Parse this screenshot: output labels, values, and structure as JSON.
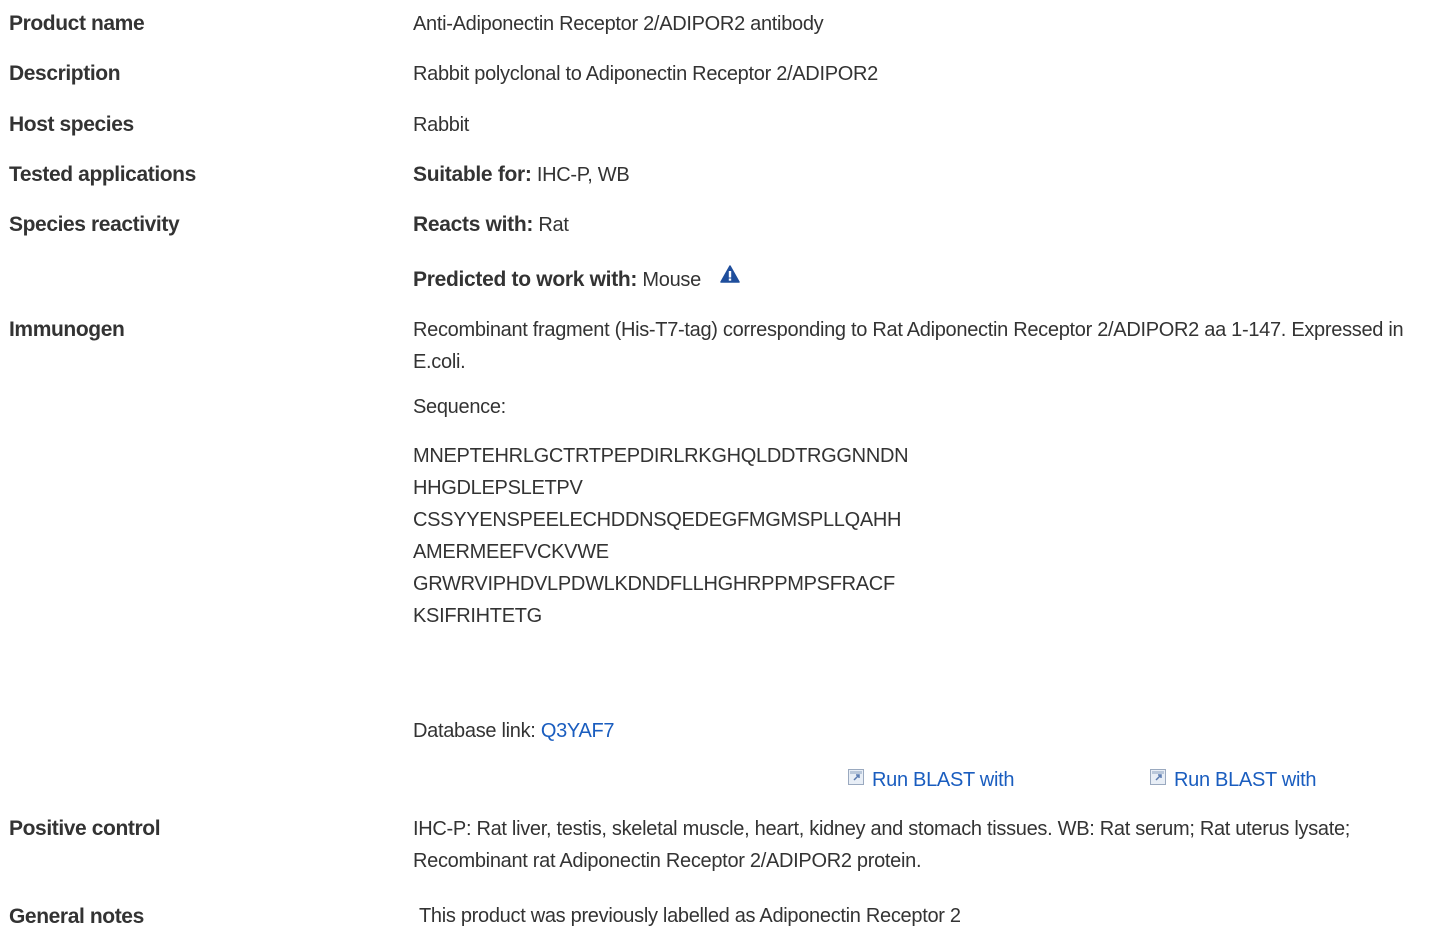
{
  "rows": {
    "product_name": {
      "label": "Product name",
      "value": "Anti-Adiponectin Receptor 2/ADIPOR2 antibody"
    },
    "description": {
      "label": "Description",
      "value": "Rabbit polyclonal to Adiponectin Receptor 2/ADIPOR2"
    },
    "host_species": {
      "label": "Host species",
      "value": "Rabbit"
    },
    "tested_applications": {
      "label": "Tested applications",
      "prefix": "Suitable for:",
      "value": "IHC-P, WB"
    },
    "species_reactivity": {
      "label": "Species reactivity",
      "reacts_prefix": "Reacts with:",
      "reacts_value": "Rat",
      "predicted_prefix": "Predicted to work with:",
      "predicted_value": "Mouse"
    },
    "immunogen": {
      "label": "Immunogen",
      "text": "Recombinant fragment (His-T7-tag) corresponding to Rat Adiponectin Receptor 2/ADIPOR2 aa 1-147. Expressed in E.coli.",
      "sequence_label": "Sequence:",
      "sequence": [
        "MNEPTEHRLGCTRTPEPDIRLRKGHQLDDTRGGNNDN",
        "HHGDLEPSLETPV",
        "CSSYYENSPEELECHDDNSQEDEGFMGMSPLLQAHH",
        "AMERMEEFVCKVWE",
        "GRWRVIPHDVLPDWLKDNDFLLHGHRPPMPSFRACF",
        "KSIFRIHTETG"
      ],
      "db_prefix": "Database link:",
      "db_link": "Q3YAF7",
      "blast_1": "Run BLAST with",
      "blast_2": "Run BLAST with"
    },
    "positive_control": {
      "label": "Positive control",
      "value": "IHC-P: Rat liver, testis, skeletal muscle, heart, kidney and stomach tissues. WB: Rat serum; Rat uterus lysate; Recombinant rat Adiponectin Receptor 2/ADIPOR2 protein."
    },
    "general_notes": {
      "label": "General notes",
      "value": "This product was previously labelled as Adiponectin Receptor 2"
    }
  },
  "colors": {
    "text": "#333333",
    "link": "#1a5dbf",
    "warning_icon": "#1f4e9c"
  },
  "icons": {
    "predicted_warning": "warning-triangle-icon",
    "blast_link": "external-link-icon"
  }
}
